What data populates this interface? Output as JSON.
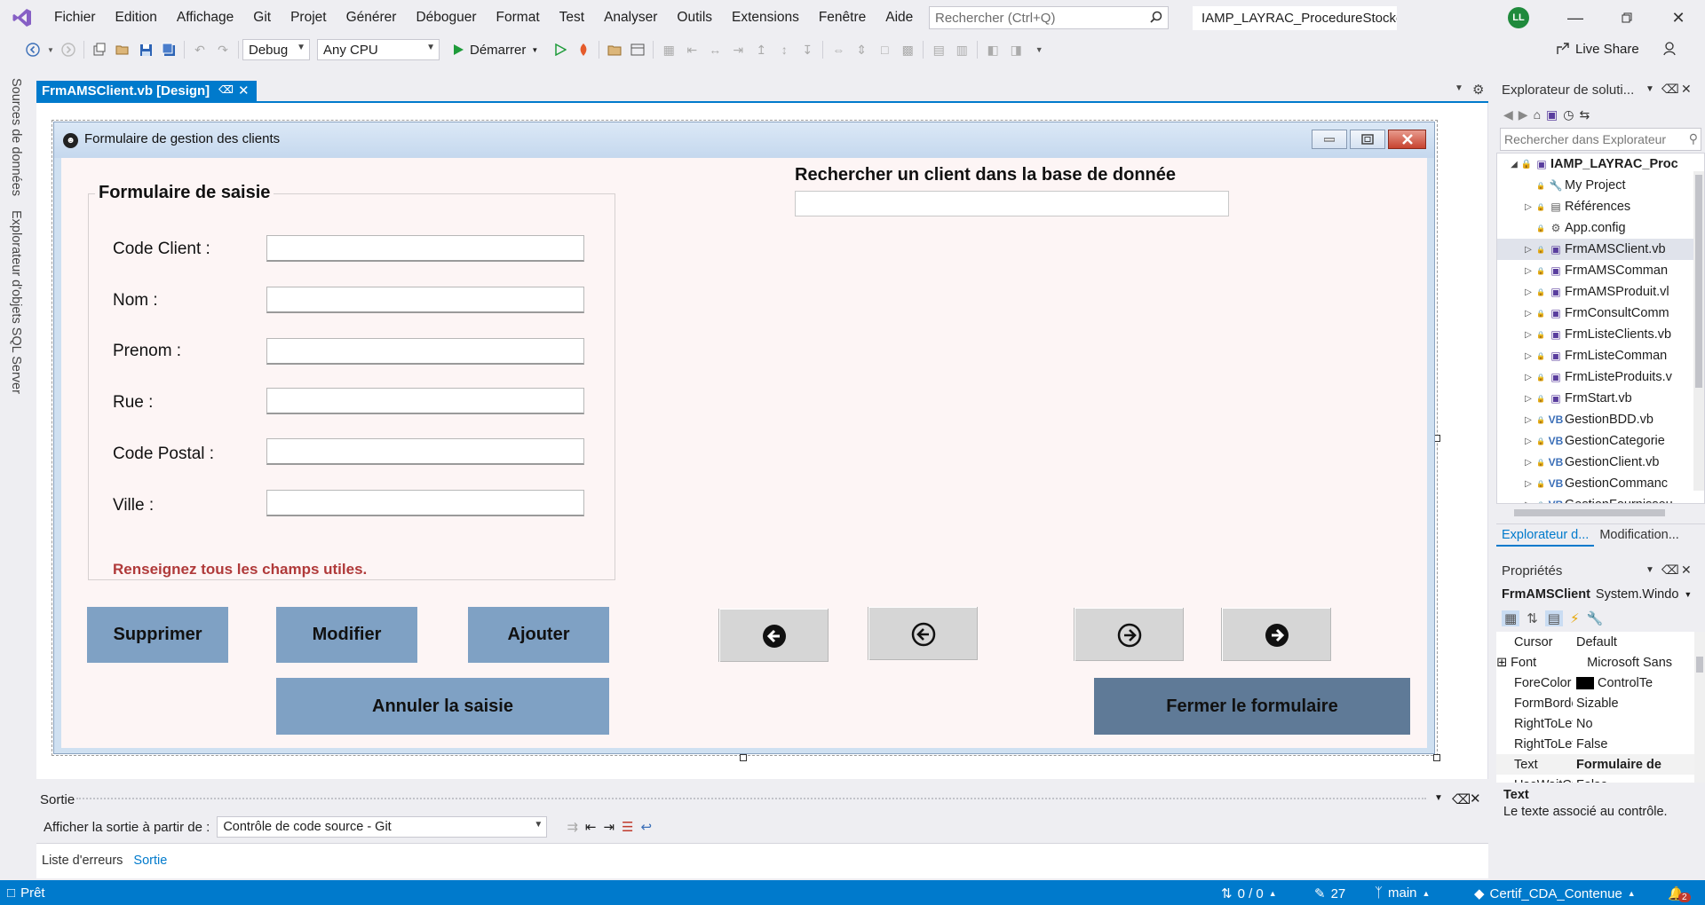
{
  "menubar": {
    "items": [
      "Fichier",
      "Edition",
      "Affichage",
      "Git",
      "Projet",
      "Générer",
      "Déboguer",
      "Format",
      "Test",
      "Analyser",
      "Outils",
      "Extensions",
      "Fenêtre",
      "Aide"
    ],
    "search_placeholder": "Rechercher (Ctrl+Q)",
    "solution_name": "IAMP_LAYRAC_ProcedureStocké",
    "avatar": "LL"
  },
  "toolbar": {
    "config": "Debug",
    "platform": "Any CPU",
    "start": "Démarrer",
    "live_share": "Live Share"
  },
  "left_rail": {
    "tab1": "Sources de données",
    "tab2": "Explorateur d'objets SQL Server"
  },
  "document_tab": {
    "title": "FrmAMSClient.vb [Design]"
  },
  "form": {
    "title": "Formulaire de gestion des clients",
    "group_title": "Formulaire de saisie",
    "fields": [
      {
        "label": "Code Client :"
      },
      {
        "label": "Nom :"
      },
      {
        "label": "Prenom :"
      },
      {
        "label": "Rue :"
      },
      {
        "label": "Code Postal :"
      },
      {
        "label": "Ville :"
      }
    ],
    "hint": "Renseignez tous les champs utiles.",
    "search_title": "Rechercher un client dans la base de donnée",
    "buttons": {
      "delete": "Supprimer",
      "modify": "Modifier",
      "add": "Ajouter",
      "cancel": "Annuler la saisie",
      "close": "Fermer le formulaire"
    }
  },
  "solution_explorer": {
    "title": "Explorateur de soluti...",
    "search_placeholder": "Rechercher dans Explorateur",
    "root": "IAMP_LAYRAC_Proc",
    "items": [
      {
        "label": "My Project",
        "icon": "wrench-icon"
      },
      {
        "label": "Références",
        "icon": "references-icon"
      },
      {
        "label": "App.config",
        "icon": "config-icon"
      },
      {
        "label": "FrmAMSClient.vb",
        "icon": "form-icon"
      },
      {
        "label": "FrmAMSComman",
        "icon": "form-icon"
      },
      {
        "label": "FrmAMSProduit.vl",
        "icon": "form-icon"
      },
      {
        "label": "FrmConsultComm",
        "icon": "form-icon"
      },
      {
        "label": "FrmListeClients.vb",
        "icon": "form-icon"
      },
      {
        "label": "FrmListeComman",
        "icon": "form-icon"
      },
      {
        "label": "FrmListeProduits.v",
        "icon": "form-icon"
      },
      {
        "label": "FrmStart.vb",
        "icon": "form-icon"
      },
      {
        "label": "GestionBDD.vb",
        "icon": "vb-icon"
      },
      {
        "label": "GestionCategorie",
        "icon": "vb-icon"
      },
      {
        "label": "GestionClient.vb",
        "icon": "vb-icon"
      },
      {
        "label": "GestionCommanc",
        "icon": "vb-icon"
      },
      {
        "label": "GestionFournisseu",
        "icon": "vb-icon"
      }
    ],
    "tab_active": "Explorateur d...",
    "tab_other": "Modification..."
  },
  "properties": {
    "title": "Propriétés",
    "object": "FrmAMSClient",
    "object_type": "System.Windo",
    "rows": [
      {
        "name": "Cursor",
        "value": "Default"
      },
      {
        "name": "Font",
        "value": "Microsoft Sans"
      },
      {
        "name": "ForeColor",
        "value": "ControlTe"
      },
      {
        "name": "FormBorder:",
        "value": "Sizable"
      },
      {
        "name": "RightToLeft",
        "value": "No"
      },
      {
        "name": "RightToLeftL",
        "value": "False"
      },
      {
        "name": "Text",
        "value": "Formulaire de"
      },
      {
        "name": "UseWaitCurs",
        "value": "False"
      }
    ],
    "desc_title": "Text",
    "desc": "Le texte associé au contrôle."
  },
  "output": {
    "title": "Sortie",
    "source_label": "Afficher la sortie à partir de :",
    "source_value": "Contrôle de code source - Git",
    "tab_errors": "Liste d'erreurs",
    "tab_output": "Sortie"
  },
  "statusbar": {
    "status": "Prêt",
    "changes": "0 / 0",
    "edits": "27",
    "branch": "main",
    "repo": "Certif_CDA_Contenue",
    "notifications": "2"
  },
  "colors": {
    "accent": "#007acc",
    "button": "#7fa1c4",
    "close_button": "#5f7a97",
    "hint": "#b03a3a"
  }
}
